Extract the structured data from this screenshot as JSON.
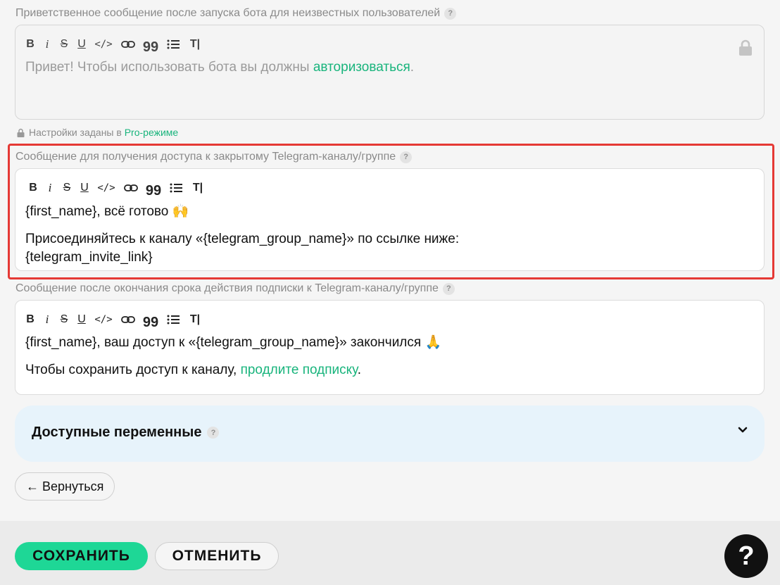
{
  "welcome_field": {
    "label": "Приветственное сообщение после запуска бота для неизвестных пользователей",
    "text_before": "Привет! Чтобы использовать бота вы должны ",
    "link_text": "авторизоваться",
    "text_after": ".",
    "pro_note_text": "Настройки заданы в ",
    "pro_note_link": "Pro-режиме"
  },
  "toolbar": {
    "bold": "B",
    "italic": "i",
    "strike": "S",
    "underline": "U",
    "code": "</>",
    "quote": "99",
    "clear_format": "T|"
  },
  "access_field": {
    "label": "Сообщение для получения доступа к закрытому Telegram-каналу/группе",
    "line1": "{first_name}, всё готово",
    "emoji1": "🙌",
    "line2": "Присоединяйтесь к каналу «{telegram_group_name}» по ссылке ниже:",
    "line3": "{telegram_invite_link}"
  },
  "expiry_field": {
    "label": "Сообщение после окончания срока действия подписки к Telegram-каналу/группе",
    "line1": "{first_name}, ваш доступ к «{telegram_group_name}» закончился",
    "emoji1": "🙏",
    "line2_before": "Чтобы сохранить доступ к каналу, ",
    "line2_link": "продлите подписку",
    "line2_after": "."
  },
  "variables_panel": {
    "title": "Доступные переменные"
  },
  "help_badge": "?",
  "back_button": "← Вернуться",
  "footer": {
    "save_label": "СОХРАНИТЬ",
    "cancel_label": "ОТМЕНИТЬ",
    "help_label": "?"
  },
  "colors": {
    "accent_green": "#1ed796",
    "link_green": "#18b47c",
    "highlight_red": "#e53935",
    "panel_blue": "#e7f3fb"
  },
  "icons": [
    "lock-icon",
    "link-icon",
    "list-icon",
    "chevron-down-icon",
    "help-icon",
    "question-icon"
  ]
}
